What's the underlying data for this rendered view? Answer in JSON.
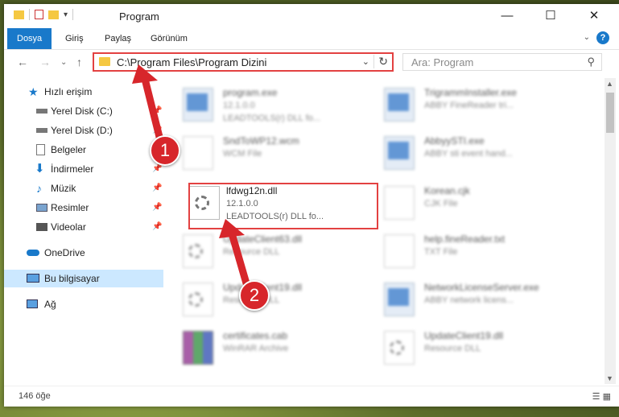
{
  "window": {
    "title": "Program",
    "controls": {
      "minimize": "—",
      "maximize": "☐",
      "close": "✕"
    }
  },
  "ribbon": {
    "tabs": [
      {
        "label": "Dosya",
        "active": true
      },
      {
        "label": "Giriş",
        "active": false
      },
      {
        "label": "Paylaş",
        "active": false
      },
      {
        "label": "Görünüm",
        "active": false
      }
    ],
    "help": "?"
  },
  "navigation": {
    "address": "C:\\Program Files\\Program Dizini",
    "search_placeholder": "Ara: Program"
  },
  "sidebar": {
    "items": [
      {
        "label": "Hızlı erişim",
        "icon": "star-icon",
        "pinned": false
      },
      {
        "label": "Yerel Disk (C:)",
        "icon": "drive-icon",
        "pinned": true
      },
      {
        "label": "Yerel Disk (D:)",
        "icon": "drive-icon",
        "pinned": true
      },
      {
        "label": "Belgeler",
        "icon": "documents-icon",
        "pinned": true
      },
      {
        "label": "İndirmeler",
        "icon": "downloads-icon",
        "pinned": true
      },
      {
        "label": "Müzik",
        "icon": "music-icon",
        "pinned": true
      },
      {
        "label": "Resimler",
        "icon": "pictures-icon",
        "pinned": true
      },
      {
        "label": "Videolar",
        "icon": "videos-icon",
        "pinned": true
      },
      {
        "label": "OneDrive",
        "icon": "cloud-icon",
        "pinned": false
      },
      {
        "label": "Bu bilgisayar",
        "icon": "computer-icon",
        "pinned": false
      },
      {
        "label": "Ağ",
        "icon": "network-icon",
        "pinned": false
      }
    ]
  },
  "files": [
    {
      "name": "program.exe",
      "type": "12.1.0.0",
      "desc": "LEADTOOLS(r) DLL fo...",
      "kind": "exe"
    },
    {
      "name": "TrigrammInstaller.exe",
      "type": "ABBY FineReader tri...",
      "desc": "",
      "kind": "exe"
    },
    {
      "name": "SndToWP12.wcm",
      "type": "WCM File",
      "desc": "",
      "kind": "doc"
    },
    {
      "name": "AbbyySTI.exe",
      "type": "ABBY sti event hand...",
      "desc": "",
      "kind": "exe"
    },
    {
      "name": "lfdwg12n.dll",
      "type": "12.1.0.0",
      "desc": "LEADTOOLS(r) DLL fo...",
      "kind": "dll"
    },
    {
      "name": "Korean.cjk",
      "type": "CJK File",
      "desc": "",
      "kind": "doc"
    },
    {
      "name": "UpdateClient63.dll",
      "type": "Resource DLL",
      "desc": "",
      "kind": "dll"
    },
    {
      "name": "help.fineReader.txt",
      "type": "TXT File",
      "desc": "",
      "kind": "doc"
    },
    {
      "name": "UpdateClient19.dll",
      "type": "Resource DLL",
      "desc": "",
      "kind": "dll"
    },
    {
      "name": "NetworkLicenseServer.exe",
      "type": "ABBY network licens...",
      "desc": "",
      "kind": "exe"
    },
    {
      "name": "certificates.cab",
      "type": "WinRAR Archive",
      "desc": "",
      "kind": "cab"
    },
    {
      "name": "UpdateClient19.dll",
      "type": "Resource DLL",
      "desc": "",
      "kind": "dll"
    }
  ],
  "status": {
    "item_count": "146 öğe"
  },
  "annotations": {
    "step1": "1",
    "step2": "2"
  },
  "colors": {
    "accent": "#1979ca",
    "highlight": "#e34141",
    "selected": "#cce8ff"
  }
}
